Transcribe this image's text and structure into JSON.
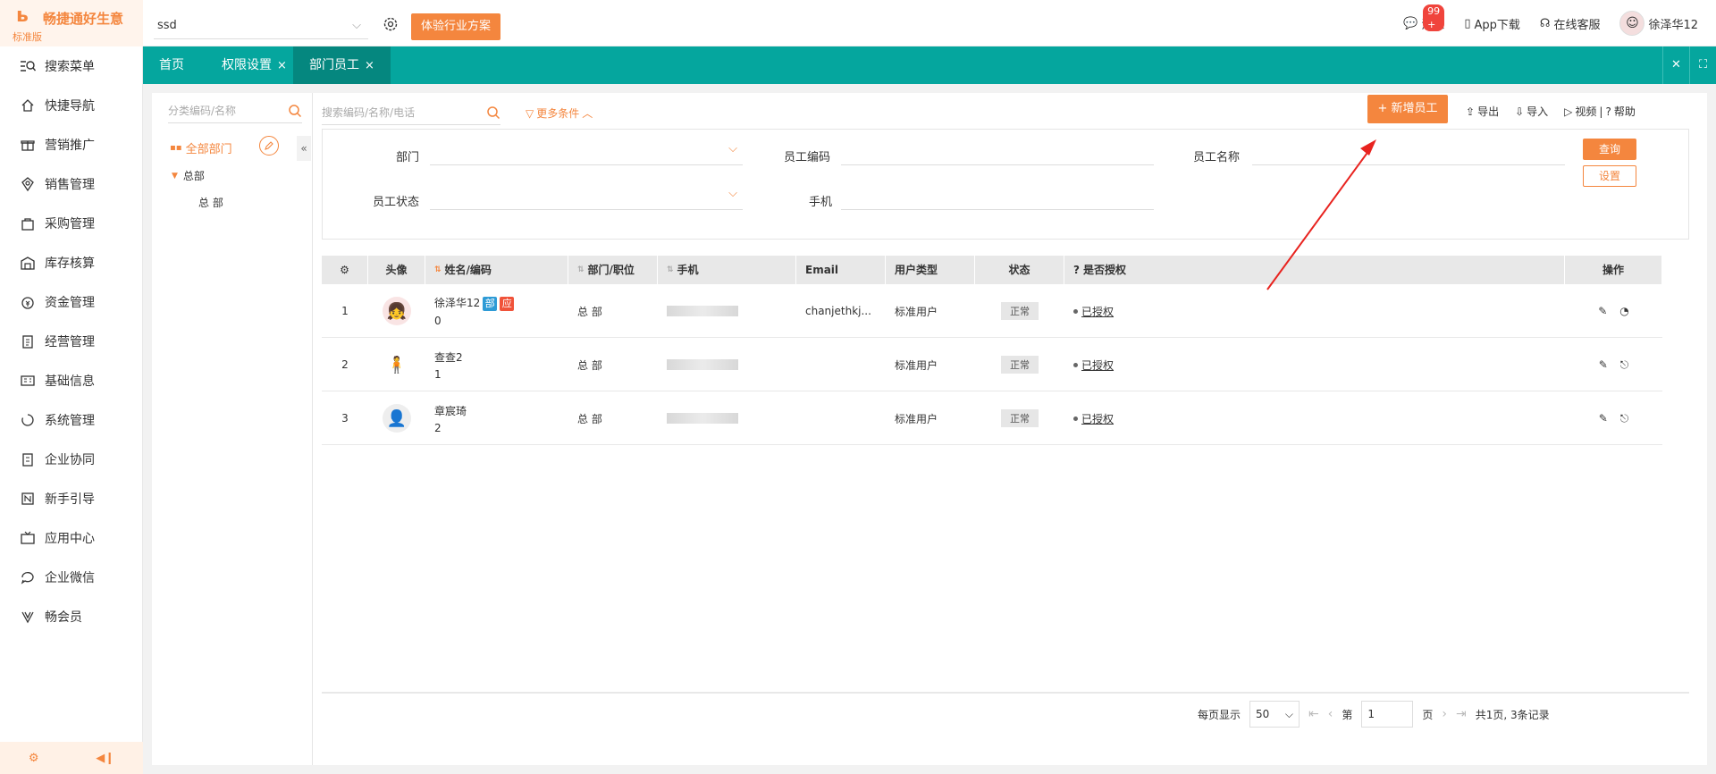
{
  "app": {
    "name": "畅捷通好生意",
    "edition": "标准版"
  },
  "sidebar": {
    "items": [
      {
        "label": "搜索菜单",
        "icon": "search-menu-icon"
      },
      {
        "label": "快捷导航",
        "icon": "home-icon"
      },
      {
        "label": "营销推广",
        "icon": "gift-icon"
      },
      {
        "label": "销售管理",
        "icon": "sales-icon"
      },
      {
        "label": "采购管理",
        "icon": "bag-icon"
      },
      {
        "label": "库存核算",
        "icon": "warehouse-icon"
      },
      {
        "label": "资金管理",
        "icon": "money-icon"
      },
      {
        "label": "经营管理",
        "icon": "clipboard-icon"
      },
      {
        "label": "基础信息",
        "icon": "id-card-icon"
      },
      {
        "label": "系统管理",
        "icon": "cycle-icon"
      },
      {
        "label": "企业协同",
        "icon": "doc-icon"
      },
      {
        "label": "新手引导",
        "icon": "new-icon"
      },
      {
        "label": "应用中心",
        "icon": "tv-icon"
      },
      {
        "label": "企业微信",
        "icon": "chat-icon"
      },
      {
        "label": "畅会员",
        "icon": "vip-icon"
      }
    ]
  },
  "topbar": {
    "company": "ssd",
    "trial_btn": "体验行业方案",
    "messages": "消息",
    "msg_badge": "99 +",
    "app_download": "App下载",
    "service": "在线客服",
    "user": "徐泽华12"
  },
  "tabs": [
    {
      "label": "首页"
    },
    {
      "label": "权限设置",
      "close": "×"
    },
    {
      "label": "部门员工",
      "close": "×"
    }
  ],
  "tree": {
    "search_placeholder": "分类编码/名称",
    "all": "全部部门",
    "node": "总部",
    "child": "总 部"
  },
  "main": {
    "search_placeholder": "搜索编码/名称/电话",
    "more": "更多条件",
    "add": "+ 新增员工",
    "export": "导出",
    "import": "导入",
    "video": "视频",
    "help": "帮助",
    "sep": "|"
  },
  "filter": {
    "dept": "部门",
    "emp_code": "员工编码",
    "emp_name": "员工名称",
    "status": "员工状态",
    "phone": "手机",
    "query": "查询",
    "settings": "设置"
  },
  "table": {
    "headers": [
      "头像",
      "姓名/编码",
      "部门/职位",
      "手机",
      "Email",
      "用户类型",
      "状态",
      "是否授权",
      "操作"
    ],
    "rows": [
      {
        "no": "1",
        "name": "徐泽华12",
        "code": "0",
        "tag1": "部",
        "tag2": "应",
        "dept": "总 部",
        "email": "chanjethkj...",
        "type": "标准用户",
        "status": "正常",
        "auth": "已授权"
      },
      {
        "no": "2",
        "name": "查查2",
        "code": "1",
        "dept": "总 部",
        "email": "",
        "type": "标准用户",
        "status": "正常",
        "auth": "已授权"
      },
      {
        "no": "3",
        "name": "章宸琦",
        "code": "2",
        "dept": "总 部",
        "email": "",
        "type": "标准用户",
        "status": "正常",
        "auth": "已授权"
      }
    ]
  },
  "pager": {
    "per_page_label": "每页显示",
    "per_page": "50",
    "page_prefix": "第",
    "page": "1",
    "page_suffix": "页",
    "summary": "共1页, 3条记录"
  },
  "colors": {
    "accent": "#f4863e",
    "teal": "#05a69e",
    "arrow": "#e8231f"
  }
}
